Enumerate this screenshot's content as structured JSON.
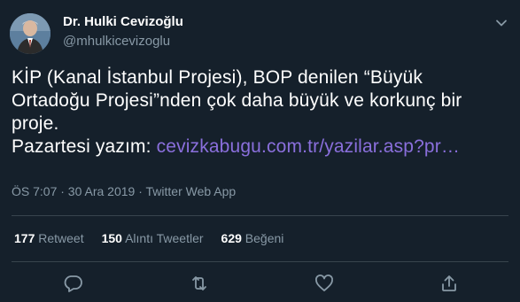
{
  "author": {
    "name": "Dr. Hulki Cevizoğlu",
    "handle": "@mhulkicevizoglu"
  },
  "tweet": {
    "lines": [
      "KİP (Kanal İstanbul Projesi), BOP denilen “Büyük",
      "Ortadoğu Projesi”nden çok daha büyük ve korkunç bir",
      "proje."
    ],
    "link_prefix": "Pazartesi yazım: ",
    "link_text": "cevizkabugu.com.tr/yazilar.asp?pr…"
  },
  "meta": {
    "timestamp": "ÖS 7:07 · 30 Ara 2019 · Twitter Web App"
  },
  "stats": {
    "retweets_count": "177",
    "retweets_label": "Retweet",
    "quotes_count": "150",
    "quotes_label": "Alıntı Tweetler",
    "likes_count": "629",
    "likes_label": "Beğeni"
  },
  "colors": {
    "background": "#15202b",
    "link": "#8a6fdc",
    "secondary_text": "#8899a6",
    "divider": "#38444d"
  },
  "icons": [
    "more-chevron-icon",
    "reply-icon",
    "retweet-icon",
    "like-icon",
    "share-icon"
  ]
}
